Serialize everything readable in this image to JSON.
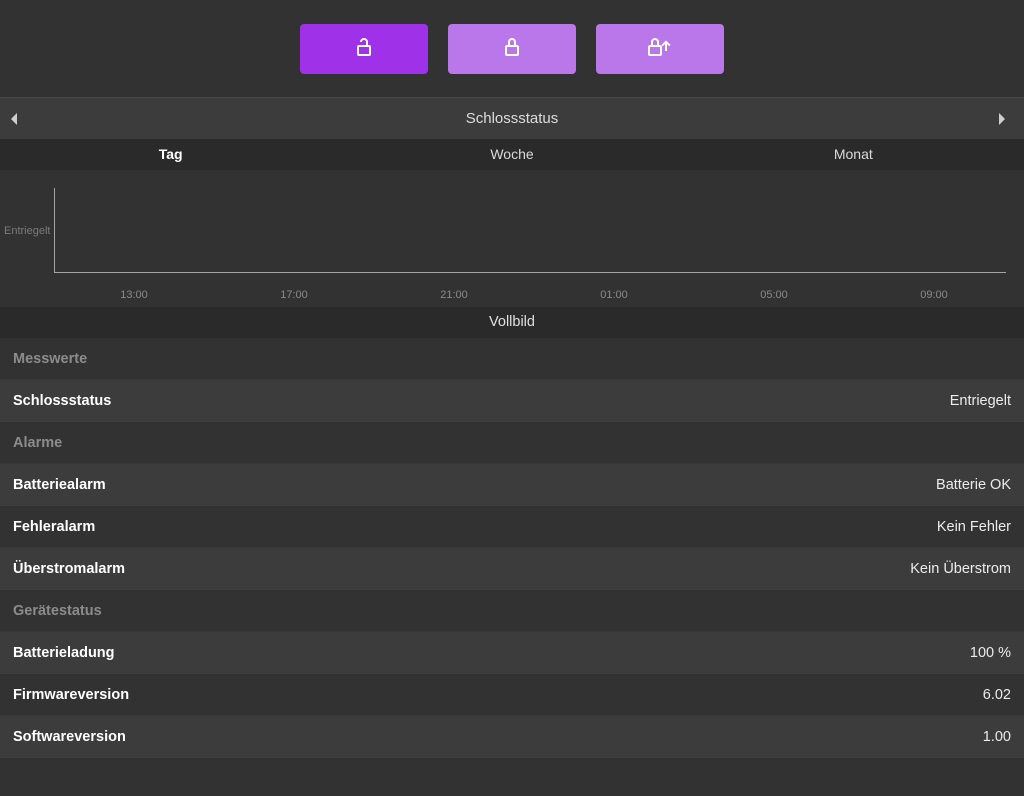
{
  "nav": {
    "title": "Schlossstatus"
  },
  "tabs": {
    "day": "Tag",
    "week": "Woche",
    "month": "Monat",
    "active": "day"
  },
  "chart_data": {
    "type": "line",
    "title": "Schlossstatus",
    "ylabel_categories": [
      "Entriegelt"
    ],
    "x_ticks": [
      "13:00",
      "17:00",
      "21:00",
      "01:00",
      "05:00",
      "09:00"
    ],
    "series": []
  },
  "fullscreen": "Vollbild",
  "sections": {
    "messwerte": {
      "header": "Messwerte",
      "rows": {
        "schlossstatus": {
          "label": "Schlossstatus",
          "value": "Entriegelt"
        }
      }
    },
    "alarme": {
      "header": "Alarme",
      "rows": {
        "batteriealarm": {
          "label": "Batteriealarm",
          "value": "Batterie OK"
        },
        "fehleralarm": {
          "label": "Fehleralarm",
          "value": "Kein Fehler"
        },
        "ueberstromalarm": {
          "label": "Überstromalarm",
          "value": "Kein Überstrom"
        }
      }
    },
    "geraetestatus": {
      "header": "Gerätestatus",
      "rows": {
        "batterieladung": {
          "label": "Batterieladung",
          "value": "100 %"
        },
        "firmwareversion": {
          "label": "Firmwareversion",
          "value": "6.02"
        },
        "softwareversion": {
          "label": "Softwareversion",
          "value": "1.00"
        }
      }
    }
  }
}
